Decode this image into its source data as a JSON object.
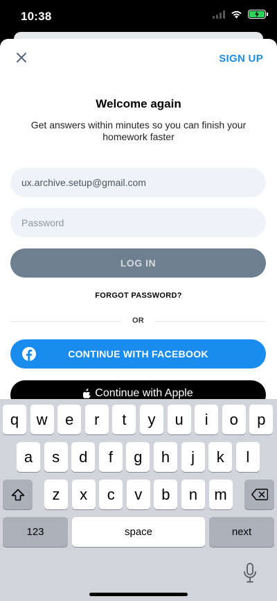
{
  "status": {
    "time": "10:38"
  },
  "nav": {
    "signup_label": "SIGN UP"
  },
  "header": {
    "title": "Welcome again",
    "subtitle": "Get answers within minutes so you can finish your homework faster"
  },
  "form": {
    "email_value": "ux.archive.setup@gmail.com",
    "password_placeholder": "Password",
    "login_label": "LOG IN",
    "forgot_label": "FORGOT PASSWORD?",
    "divider_label": "OR"
  },
  "social": {
    "facebook_label": "CONTINUE WITH FACEBOOK",
    "apple_label": "Continue with Apple"
  },
  "keyboard": {
    "row1": [
      "q",
      "w",
      "e",
      "r",
      "t",
      "y",
      "u",
      "i",
      "o",
      "p"
    ],
    "row2": [
      "a",
      "s",
      "d",
      "f",
      "g",
      "h",
      "j",
      "k",
      "l"
    ],
    "row3": [
      "z",
      "x",
      "c",
      "v",
      "b",
      "n",
      "m"
    ],
    "numbers_label": "123",
    "space_label": "space",
    "next_label": "next"
  },
  "colors": {
    "accent": "#1a8ce6",
    "facebook": "#1a8cf0",
    "login_disabled": "#6e7f8f",
    "field_bg": "#eff3f7"
  }
}
